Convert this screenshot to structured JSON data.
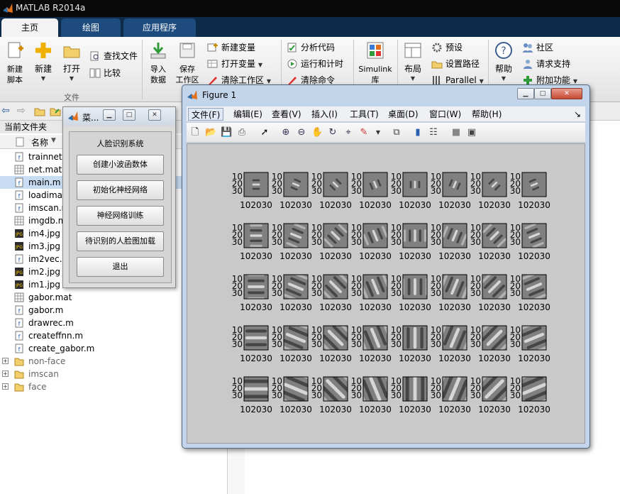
{
  "app": {
    "title": "MATLAB R2014a",
    "tabs": [
      {
        "label": "主页"
      },
      {
        "label": "绘图"
      },
      {
        "label": "应用程序"
      }
    ]
  },
  "ribbon": {
    "new_script": "新建\n脚本",
    "new": "新建",
    "open": "打开",
    "find_files": "查找文件",
    "compare": "比较",
    "file_group": "文件",
    "import_data": "导入\n数据",
    "save_workspace": "保存\n工作区",
    "new_variable": "新建变量",
    "open_variable": "打开变量",
    "clear_workspace": "清除工作区",
    "analyze_code": "分析代码",
    "run_and_time": "运行和计时",
    "clear_commands": "清除命令",
    "simulink": "Simulink\n库",
    "layout": "布局",
    "preferences": "预设",
    "set_path": "设置路径",
    "parallel": "Parallel",
    "help": "帮助",
    "community": "社区",
    "request_support": "请求支持",
    "add_ons": "附加功能"
  },
  "file_panel": {
    "title": "当前文件夹",
    "column_name": "名称",
    "files": [
      {
        "name": "trainnet.m",
        "icon": "m-file-icon"
      },
      {
        "name": "net.mat",
        "icon": "mat-file-icon"
      },
      {
        "name": "main.m",
        "icon": "m-file-icon",
        "selected": true
      },
      {
        "name": "loadimages.m",
        "icon": "m-file-icon"
      },
      {
        "name": "imscan.m",
        "icon": "m-file-icon"
      },
      {
        "name": "imgdb.mat",
        "icon": "mat-file-icon"
      },
      {
        "name": "im4.jpg",
        "icon": "jpg-file-icon"
      },
      {
        "name": "im3.jpg",
        "icon": "jpg-file-icon"
      },
      {
        "name": "im2vec.m",
        "icon": "m-file-icon"
      },
      {
        "name": "im2.jpg",
        "icon": "jpg-file-icon"
      },
      {
        "name": "im1.jpg",
        "icon": "jpg-file-icon"
      },
      {
        "name": "gabor.mat",
        "icon": "mat-file-icon"
      },
      {
        "name": "gabor.m",
        "icon": "m-file-icon"
      },
      {
        "name": "drawrec.m",
        "icon": "m-file-icon"
      },
      {
        "name": "createffnn.m",
        "icon": "m-file-icon"
      },
      {
        "name": "create_gabor.m",
        "icon": "m-file-icon"
      },
      {
        "name": "non-face",
        "icon": "folder-icon",
        "folder": true
      },
      {
        "name": "imscan",
        "icon": "folder-icon",
        "folder": true
      },
      {
        "name": "face",
        "icon": "folder-icon",
        "folder": true
      }
    ]
  },
  "menu_window": {
    "title": "菜...",
    "heading": "人脸识别系统",
    "buttons": [
      "创建小波函数体",
      "初始化神经网络",
      "神经网络训练",
      "待识别的人脸图加载",
      "退出"
    ]
  },
  "figure": {
    "title": "Figure 1",
    "menus": [
      "文件(F)",
      "编辑(E)",
      "查看(V)",
      "插入(I)",
      "工具(T)",
      "桌面(D)",
      "窗口(W)",
      "帮助(H)"
    ],
    "grid": {
      "rows": 5,
      "cols": 8
    },
    "ytick_labels": [
      "10",
      "20",
      "30"
    ],
    "xtick_label": "102030"
  }
}
